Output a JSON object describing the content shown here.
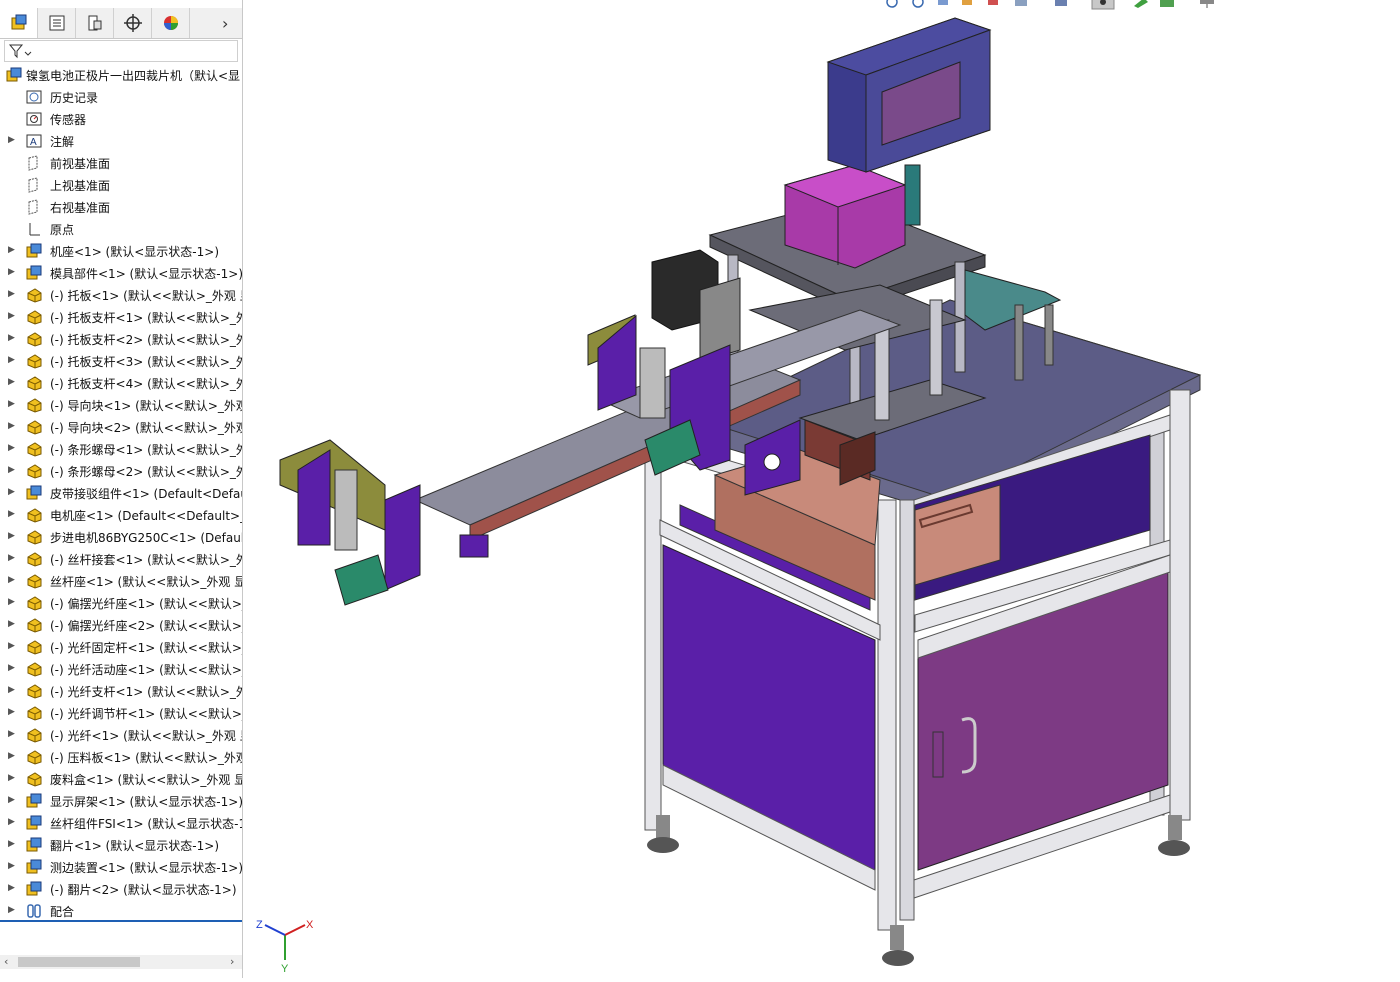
{
  "tree": {
    "root_label": "镍氢电池正极片一出四裁片机（默认<显",
    "items": [
      {
        "label": "历史记录",
        "icon": "history-icon",
        "expandable": false
      },
      {
        "label": "传感器",
        "icon": "sensor-icon",
        "expandable": false
      },
      {
        "label": "注解",
        "icon": "annotation-icon",
        "expandable": true
      },
      {
        "label": "前视基准面",
        "icon": "plane-icon",
        "expandable": false
      },
      {
        "label": "上视基准面",
        "icon": "plane-icon",
        "expandable": false
      },
      {
        "label": "右视基准面",
        "icon": "plane-icon",
        "expandable": false
      },
      {
        "label": "原点",
        "icon": "origin-icon",
        "expandable": false
      },
      {
        "label": "机座<1> (默认<显示状态-1>)",
        "icon": "assembly-icon",
        "expandable": true
      },
      {
        "label": "模具部件<1> (默认<显示状态-1>)",
        "icon": "assembly-icon",
        "expandable": true
      },
      {
        "label": "(-) 托板<1> (默认<<默认>_外观 显",
        "icon": "part-icon",
        "expandable": true
      },
      {
        "label": "(-) 托板支杆<1> (默认<<默认>_外",
        "icon": "part-icon",
        "expandable": true
      },
      {
        "label": "(-) 托板支杆<2> (默认<<默认>_外",
        "icon": "part-icon",
        "expandable": true
      },
      {
        "label": "(-) 托板支杆<3> (默认<<默认>_外",
        "icon": "part-icon",
        "expandable": true
      },
      {
        "label": "(-) 托板支杆<4> (默认<<默认>_外",
        "icon": "part-icon",
        "expandable": true
      },
      {
        "label": "(-) 导向块<1> (默认<<默认>_外观",
        "icon": "part-icon",
        "expandable": true
      },
      {
        "label": "(-) 导向块<2> (默认<<默认>_外观",
        "icon": "part-icon",
        "expandable": true
      },
      {
        "label": "(-) 条形螺母<1> (默认<<默认>_外",
        "icon": "part-icon",
        "expandable": true
      },
      {
        "label": "(-) 条形螺母<2> (默认<<默认>_外",
        "icon": "part-icon",
        "expandable": true
      },
      {
        "label": "皮带接驳组件<1> (Default<Defau",
        "icon": "assembly-icon",
        "expandable": true
      },
      {
        "label": "电机座<1> (Default<<Default>_外",
        "icon": "part-icon",
        "expandable": true
      },
      {
        "label": "步进电机86BYG250C<1> (Default",
        "icon": "part-icon",
        "expandable": true
      },
      {
        "label": "(-) 丝杆接套<1> (默认<<默认>_外",
        "icon": "part-icon",
        "expandable": true
      },
      {
        "label": "丝杆座<1> (默认<<默认>_外观 显:",
        "icon": "part-icon",
        "expandable": true
      },
      {
        "label": "(-) 偏摆光纤座<1> (默认<<默认>_",
        "icon": "part-icon",
        "expandable": true
      },
      {
        "label": "(-) 偏摆光纤座<2> (默认<<默认>_",
        "icon": "part-icon",
        "expandable": true
      },
      {
        "label": "(-) 光纤固定杆<1> (默认<<默认>_",
        "icon": "part-icon",
        "expandable": true
      },
      {
        "label": "(-) 光纤活动座<1> (默认<<默认>_",
        "icon": "part-icon",
        "expandable": true
      },
      {
        "label": "(-) 光纤支杆<1> (默认<<默认>_外",
        "icon": "part-icon",
        "expandable": true
      },
      {
        "label": "(-) 光纤调节杆<1> (默认<<默认>_",
        "icon": "part-icon",
        "expandable": true
      },
      {
        "label": "(-) 光纤<1> (默认<<默认>_外观 显",
        "icon": "part-icon",
        "expandable": true
      },
      {
        "label": "(-) 压料板<1> (默认<<默认>_外观",
        "icon": "part-icon",
        "expandable": true
      },
      {
        "label": "废料盒<1> (默认<<默认>_外观 显:",
        "icon": "part-icon",
        "expandable": true
      },
      {
        "label": "显示屏架<1> (默认<显示状态-1>)",
        "icon": "assembly-icon",
        "expandable": true
      },
      {
        "label": "丝杆组件FSI<1> (默认<显示状态-1",
        "icon": "assembly-icon",
        "expandable": true
      },
      {
        "label": "翻片<1> (默认<显示状态-1>)",
        "icon": "assembly-icon",
        "expandable": true
      },
      {
        "label": "测边装置<1> (默认<显示状态-1>)",
        "icon": "assembly-icon",
        "expandable": true
      },
      {
        "label": "(-) 翻片<2> (默认<显示状态-1>)",
        "icon": "assembly-icon",
        "expandable": true
      },
      {
        "label": "配合",
        "icon": "mates-icon",
        "expandable": true
      }
    ]
  },
  "triad": {
    "x": "X",
    "y": "Y",
    "z": "Z"
  },
  "colors": {
    "purple": "#5a1fa8",
    "mauve": "#7d3a84",
    "frame": "#e6e6ea",
    "steel": "#7a7a8e",
    "navy": "#3b3b8c",
    "magenta": "#a83aa8",
    "olive": "#8c8c3c",
    "salmon": "#c88a7a"
  }
}
